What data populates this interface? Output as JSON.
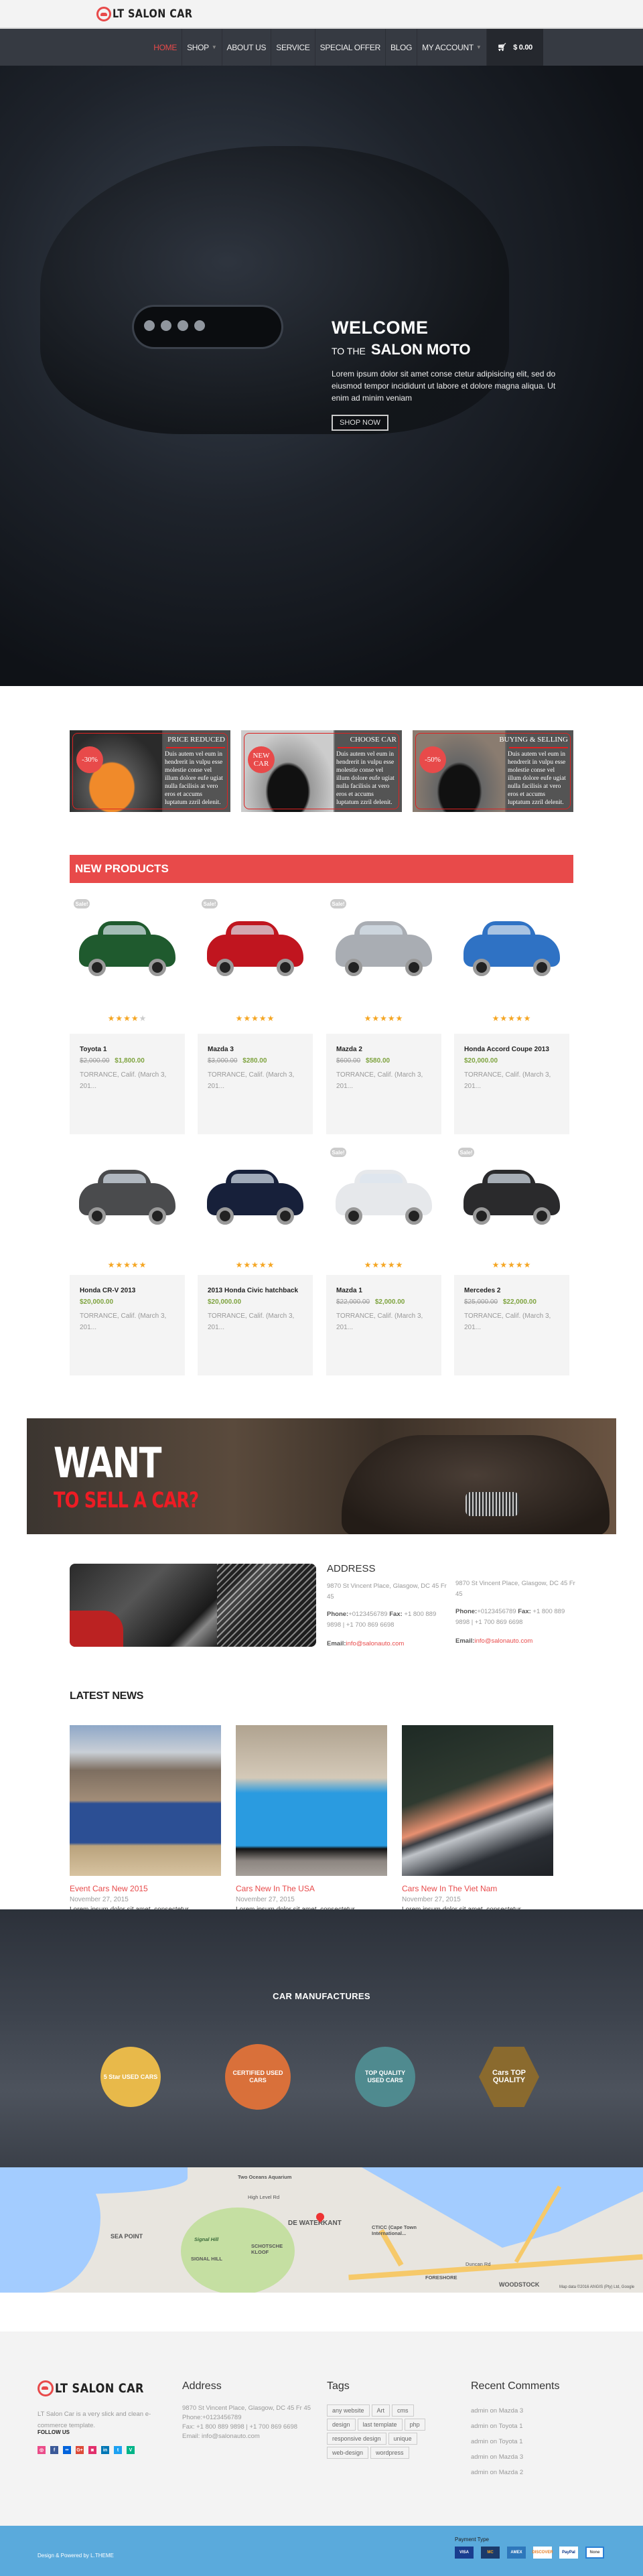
{
  "brand": {
    "name": "LT SALON CAR",
    "accent": "#e84a4a"
  },
  "nav": {
    "items": [
      {
        "label": "HOME",
        "active": true
      },
      {
        "label": "SHOP",
        "dropdown": true
      },
      {
        "label": "ABOUT US"
      },
      {
        "label": "SERVICE"
      },
      {
        "label": "SPECIAL OFFER"
      },
      {
        "label": "BLOG"
      },
      {
        "label": "MY ACCOUNT",
        "dropdown": true
      }
    ],
    "cart_total": "$ 0.00",
    "cart_icon": "shopping-cart-icon"
  },
  "hero": {
    "welcome": "WELCOME",
    "to_the": "TO THE",
    "salon": "SALON MOTO",
    "body": "Lorem ipsum dolor sit amet conse ctetur adipisicing elit, sed do eiusmod tempor incididunt ut labore et dolore magna aliqua. Ut enim ad minim veniam",
    "button": "SHOP NOW"
  },
  "promos": [
    {
      "badge": "-30%",
      "title": "PRICE REDUCED",
      "text": "Duis autem vel eum in hendrerit in vulpu esse molestie conse vel illum dolore eufe ugiat nulla facilisis at vero eros et accums luptatum zzril delenit."
    },
    {
      "badge": "NEW CAR",
      "title": "CHOOSE CAR",
      "text": "Duis autem vel eum in hendrerit in vulpu esse molestie conse vel illum dolore eufe ugiat nulla facilisis at vero eros et accums luptatum zzril delenit."
    },
    {
      "badge": "-50%",
      "title": "BUYING & SELLING",
      "text": "Duis autem vel eum in hendrerit in vulpu esse molestie conse vel illum dolore eufe ugiat nulla facilisis at vero eros et accums luptatum zzril delenit."
    }
  ],
  "new_products": {
    "title": "NEW PRODUCTS",
    "sale_label": "Sale!",
    "items": [
      {
        "name": "Toyota 1",
        "old_price": "$2,000.00",
        "price": "$1,800.00",
        "rating": 4,
        "sale": true,
        "desc": "TORRANCE, Calif. (March 3, 201...",
        "color": "#1f5a2e"
      },
      {
        "name": "Mazda 3",
        "old_price": "$3,000.00",
        "price": "$280.00",
        "rating": 5,
        "sale": true,
        "desc": "TORRANCE, Calif. (March 3, 201...",
        "color": "#c0151f"
      },
      {
        "name": "Mazda 2",
        "old_price": "$600.00",
        "price": "$580.00",
        "rating": 5,
        "sale": true,
        "desc": "TORRANCE, Calif. (March 3, 201...",
        "color": "#a9adb3"
      },
      {
        "name": "Honda Accord Coupe 2013",
        "old_price": "",
        "price": "$20,000.00",
        "rating": 5,
        "sale": false,
        "desc": "TORRANCE, Calif. (March 3, 201...",
        "color": "#2f72c4"
      },
      {
        "name": "Honda CR-V 2013",
        "old_price": "",
        "price": "$20,000.00",
        "rating": 5,
        "sale": false,
        "desc": "TORRANCE, Calif. (March 3, 201...",
        "color": "#4a4b4d"
      },
      {
        "name": "2013 Honda Civic hatchback",
        "old_price": "",
        "price": "$20,000.00",
        "rating": 5,
        "sale": false,
        "desc": "TORRANCE, Calif. (March 3, 201...",
        "color": "#17203a"
      },
      {
        "name": "Mazda 1",
        "old_price": "$22,000.00",
        "price": "$2,000.00",
        "rating": 5,
        "sale": true,
        "desc": "TORRANCE, Calif. (March 3, 201...",
        "color": "#e6e8eb"
      },
      {
        "name": "Mercedes 2",
        "old_price": "$25,000.00",
        "price": "$22,000.00",
        "rating": 5,
        "sale": true,
        "desc": "TORRANCE, Calif. (March 3, 201...",
        "color": "#2a2a2c"
      }
    ]
  },
  "sell_banner": {
    "line1": "WANT",
    "line2": "TO SELL A CAR?"
  },
  "address_block": {
    "title": "ADDRESS",
    "columns": [
      {
        "address": "9870 St Vincent Place, Glasgow, DC 45 Fr 45",
        "phone_label": "Phone:",
        "phone": "+0123456789",
        "fax_label": "Fax:",
        "fax": "+1 800 889 9898 | +1 700 869 6698",
        "email_label": "Email:",
        "email": "info@salonauto.com"
      },
      {
        "address": "9870 St Vincent Place, Glasgow, DC 45 Fr 45",
        "phone_label": "Phone:",
        "phone": "+0123456789",
        "fax_label": "Fax:",
        "fax": "+1 800 889 9898 | +1 700 869 6698",
        "email_label": "Email:",
        "email": "info@salonauto.com"
      }
    ]
  },
  "news": {
    "title": "LATEST NEWS",
    "items": [
      {
        "title": "Event Cars New 2015",
        "date": "November 27, 2015",
        "excerpt": "Lorem ipsum dolor sit amet, consectetur ..."
      },
      {
        "title": "Cars New In The USA",
        "date": "November 27, 2015",
        "excerpt": "Lorem ipsum dolor sit amet, consectetur ..."
      },
      {
        "title": "Cars New In The Viet Nam",
        "date": "November 27, 2015",
        "excerpt": "Lorem ipsum dolor sit amet, consectetur ..."
      }
    ]
  },
  "manufacturers": {
    "title": "CAR MANUFACTURES",
    "badges": [
      {
        "text": "5 Star USED CARS",
        "color": "#e8b94a"
      },
      {
        "text": "CERTIFIED USED CARS",
        "color": "#d9703a"
      },
      {
        "text": "TOP QUALITY USED CARS",
        "color": "#4f8a8f"
      },
      {
        "text": "Cars TOP QUALITY",
        "color": "#8a6a2e"
      }
    ]
  },
  "map": {
    "labels": [
      "Two Oceans Aquarium",
      "DE WATERKANT",
      "SEA POINT",
      "Signal Hill",
      "SIGNAL HILL",
      "SCHOTSCHE KLOOF",
      "CTICC (Cape Town International...",
      "FORESHORE",
      "WOODSTOCK",
      "High Level Rd",
      "Duncan Rd"
    ],
    "attribution": "Map data ©2016 AfriGIS (Pty) Ltd, Google"
  },
  "footer": {
    "brand": "LT SALON CAR",
    "desc": "LT Salon Car is a very slick and clean e-commerce template.",
    "follow": "FOLLOW US",
    "social": [
      {
        "icon": "dribbble-icon",
        "glyph": "◎",
        "color": "#ea4c89"
      },
      {
        "icon": "facebook-icon",
        "glyph": "f",
        "color": "#3b5998"
      },
      {
        "icon": "flickr-icon",
        "glyph": "••",
        "color": "#0063dc"
      },
      {
        "icon": "google-plus-icon",
        "glyph": "G+",
        "color": "#dd4b39"
      },
      {
        "icon": "instagram-icon",
        "glyph": "◙",
        "color": "#e1306c"
      },
      {
        "icon": "linkedin-icon",
        "glyph": "in",
        "color": "#0077b5"
      },
      {
        "icon": "twitter-icon",
        "glyph": "t",
        "color": "#1da1f2"
      },
      {
        "icon": "vine-icon",
        "glyph": "V",
        "color": "#00b488"
      }
    ],
    "address_title": "Address",
    "address_lines": [
      "9870 St Vincent Place, Glasgow, DC 45 Fr 45",
      "Phone:+0123456789",
      "Fax: +1 800 889 9898 | +1 700 869 6698",
      "Email: info@salonauto.com"
    ],
    "tags_title": "Tags",
    "tags": [
      "any website",
      "Art",
      "cms",
      "design",
      "last template",
      "php",
      "responsive design",
      "unique",
      "web-design",
      "wordpress"
    ],
    "comments_title": "Recent Comments",
    "comments": [
      {
        "author": "admin",
        "on": "on",
        "target": "Mazda 3"
      },
      {
        "author": "admin",
        "on": "on",
        "target": "Toyota 1"
      },
      {
        "author": "admin",
        "on": "on",
        "target": "Toyota 1"
      },
      {
        "author": "admin",
        "on": "on",
        "target": "Mazda 3"
      },
      {
        "author": "admin",
        "on": "on",
        "target": "Mazda 2"
      }
    ]
  },
  "bottom": {
    "copyright": "Design & Powered by L.THEME",
    "payment_title": "Payment Type",
    "payments": [
      {
        "label": "VISA",
        "bg": "#1a3d8f",
        "fg": "#fff"
      },
      {
        "label": "MC",
        "bg": "#1b3a6b",
        "fg": "#f5a623"
      },
      {
        "label": "AMEX",
        "bg": "#2e77bb",
        "fg": "#fff"
      },
      {
        "label": "DISCOVER",
        "bg": "#fff",
        "fg": "#e67e22"
      },
      {
        "label": "PayPal",
        "bg": "#fff",
        "fg": "#003087"
      },
      {
        "label": "None",
        "bg": "#fff",
        "fg": "#555"
      }
    ]
  }
}
